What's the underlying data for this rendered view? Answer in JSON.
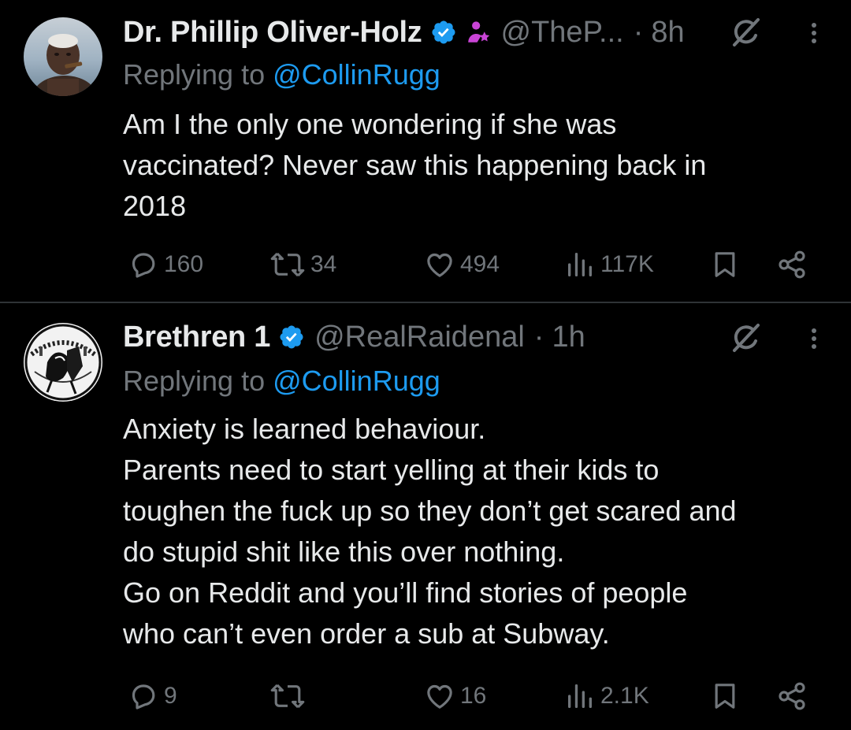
{
  "colors": {
    "background": "#000000",
    "text": "#e7e9ea",
    "secondary": "#71767b",
    "link": "#1d9bf0",
    "verified": "#1d9bf0",
    "affiliation": "#c944d6",
    "divider": "#2f3336"
  },
  "tweets": [
    {
      "author_name": "Dr. Phillip Oliver-Holz",
      "handle": "@TheP...",
      "separator": "·",
      "time": "8h",
      "reply_prefix": "Replying to ",
      "reply_handle": "@CollinRugg",
      "text_lines": [
        "Am I the only one wondering if she was",
        "vaccinated? Never saw this happening back in",
        "2018"
      ],
      "stats": {
        "replies": "160",
        "reposts": "34",
        "likes": "494",
        "views": "117K"
      },
      "icons": [
        "verified-badge-icon",
        "affiliation-icon",
        "grok-icon",
        "more-icon"
      ]
    },
    {
      "author_name": "Brethren 1",
      "handle": "@RealRaidenal",
      "separator": "·",
      "time": "1h",
      "reply_prefix": "Replying to ",
      "reply_handle": "@CollinRugg",
      "text_lines": [
        "Anxiety is learned behaviour.",
        "Parents need to start yelling at their kids to",
        "toughen the fuck up so they don’t get scared and",
        "do stupid shit like this over nothing.",
        "Go on Reddit and you’ll find stories of people",
        "who can’t even order a sub at Subway."
      ],
      "stats": {
        "replies": "9",
        "reposts": "",
        "likes": "16",
        "views": "2.1K"
      },
      "icons": [
        "verified-badge-icon",
        "grok-icon",
        "more-icon"
      ]
    }
  ]
}
